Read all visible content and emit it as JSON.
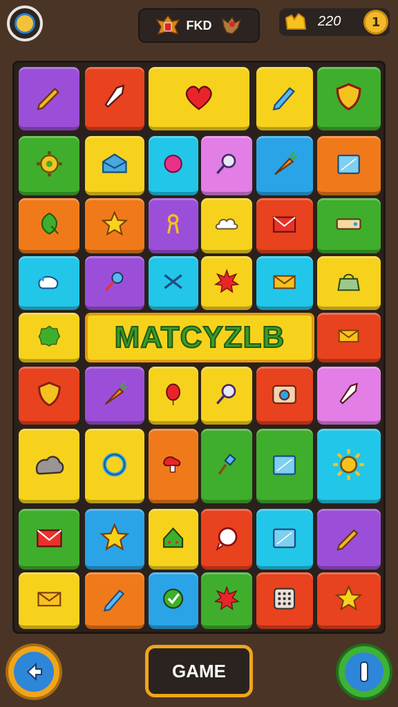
{
  "header": {
    "title": "FKD",
    "coin_count": "220",
    "coin_symbol": "1"
  },
  "banner": {
    "text": "MATCYZLB"
  },
  "footer": {
    "game_label": "GAME"
  },
  "colors": {
    "purple": "#9b4fd8",
    "red": "#e8421e",
    "yellow": "#f7d21c",
    "green": "#3fae2c",
    "blue": "#2aa4e6",
    "orange": "#f07a1a",
    "pink": "#e27ee6",
    "cyan": "#22c6e8"
  },
  "tiles": [
    {
      "color": "purple",
      "icon": "pencil-icon"
    },
    {
      "color": "red",
      "icon": "rocket-icon"
    },
    {
      "color": "yellow",
      "icon": "heart-icon"
    },
    {
      "color": "yellow",
      "icon": "pen-icon"
    },
    {
      "color": "green",
      "icon": "shield-icon"
    },
    {
      "color": "green",
      "icon": "gear-icon"
    },
    {
      "color": "yellow",
      "icon": "envelope-open-icon"
    },
    {
      "color": "cyan",
      "icon": "ball-icon"
    },
    {
      "color": "pink",
      "icon": "magnifier-icon"
    },
    {
      "color": "blue",
      "icon": "carrot-icon"
    },
    {
      "color": "orange",
      "icon": "folder-icon"
    },
    {
      "color": "orange",
      "icon": "leaf-icon"
    },
    {
      "color": "orange",
      "icon": "star-icon"
    },
    {
      "color": "purple",
      "icon": "key-icon"
    },
    {
      "color": "yellow",
      "icon": "cloud-icon"
    },
    {
      "color": "red",
      "icon": "mail-icon"
    },
    {
      "color": "green",
      "icon": "ticket-icon"
    },
    {
      "color": "cyan",
      "icon": "bird-icon"
    },
    {
      "color": "purple",
      "icon": "pushpin-icon"
    },
    {
      "color": "cyan",
      "icon": "scissors-icon"
    },
    {
      "color": "yellow",
      "icon": "burst-icon"
    },
    {
      "color": "cyan",
      "icon": "envelope-icon"
    },
    {
      "color": "yellow",
      "icon": "bag-icon"
    },
    {
      "color": "yellow",
      "icon": "blob-icon"
    },
    {
      "color": "red",
      "icon": "envelope-icon"
    },
    {
      "color": "red",
      "icon": "shield-icon"
    },
    {
      "color": "purple",
      "icon": "carrot-icon"
    },
    {
      "color": "yellow",
      "icon": "balloon-icon"
    },
    {
      "color": "yellow",
      "icon": "magnifier-icon"
    },
    {
      "color": "red",
      "icon": "camera-icon"
    },
    {
      "color": "pink",
      "icon": "rocket-icon"
    },
    {
      "color": "yellow",
      "icon": "rock-icon"
    },
    {
      "color": "yellow",
      "icon": "ring-icon"
    },
    {
      "color": "orange",
      "icon": "mushroom-icon"
    },
    {
      "color": "green",
      "icon": "pin-icon"
    },
    {
      "color": "green",
      "icon": "folder-icon"
    },
    {
      "color": "cyan",
      "icon": "sun-icon"
    },
    {
      "color": "green",
      "icon": "mail-icon"
    },
    {
      "color": "blue",
      "icon": "star-icon"
    },
    {
      "color": "yellow",
      "icon": "house-icon"
    },
    {
      "color": "red",
      "icon": "chat-icon"
    },
    {
      "color": "cyan",
      "icon": "folder-icon"
    },
    {
      "color": "purple",
      "icon": "pencil-icon"
    },
    {
      "color": "yellow",
      "icon": "envelope-icon"
    },
    {
      "color": "orange",
      "icon": "pen-icon"
    },
    {
      "color": "blue",
      "icon": "check-icon"
    },
    {
      "color": "green",
      "icon": "burst-icon"
    },
    {
      "color": "red",
      "icon": "keypad-icon"
    },
    {
      "color": "red",
      "icon": "star-icon"
    }
  ]
}
